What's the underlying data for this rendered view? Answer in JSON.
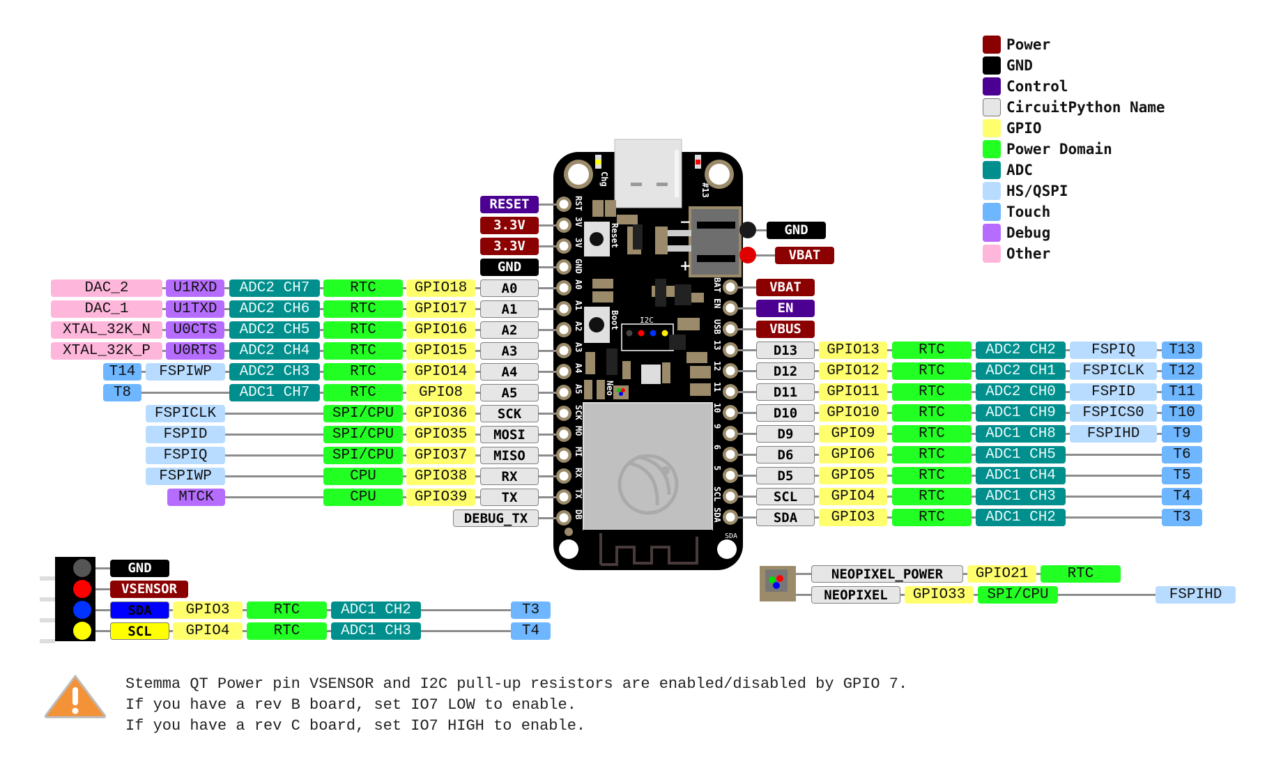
{
  "legend": [
    {
      "label": "Power",
      "color": "#8b0000"
    },
    {
      "label": "GND",
      "color": "#000000"
    },
    {
      "label": "Control",
      "color": "#4b0092"
    },
    {
      "label": "CircuitPython Name",
      "color": "#e6e6e6"
    },
    {
      "label": "GPIO",
      "color": "#ffff6e"
    },
    {
      "label": "Power Domain",
      "color": "#22ff22"
    },
    {
      "label": "ADC",
      "color": "#008f8c"
    },
    {
      "label": "HS/QSPI",
      "color": "#b8dcff"
    },
    {
      "label": "Touch",
      "color": "#6eb6ff"
    },
    {
      "label": "Debug",
      "color": "#b66dff"
    },
    {
      "label": "Other",
      "color": "#ffb6db"
    }
  ],
  "board": {
    "silkscreen_left": [
      "RST",
      "3V",
      "3V",
      "GND",
      "A0",
      "A1",
      "A2",
      "A3",
      "A4",
      "A5",
      "SCK",
      "MO",
      "MI",
      "RX",
      "TX",
      "DB"
    ],
    "silkscreen_right": [
      "BAT",
      "EN",
      "USB",
      "13",
      "12",
      "11",
      "10",
      "9",
      "6",
      "5",
      "SCL",
      "SDA"
    ],
    "labels": {
      "chg": "Chg",
      "led13": "#13",
      "reset": "Reset",
      "boot": "Boot",
      "i2c": "I2C",
      "neo": "Neo"
    }
  },
  "left_pins": [
    {
      "name": "RESET",
      "type": "control"
    },
    {
      "name": "3.3V",
      "type": "power"
    },
    {
      "name": "3.3V",
      "type": "power"
    },
    {
      "name": "GND",
      "type": "gnd"
    },
    {
      "name": "A0",
      "gpio": "GPIO18",
      "domain": "RTC",
      "adc": "ADC2 CH7",
      "debug": "U1RXD",
      "other": "DAC_2"
    },
    {
      "name": "A1",
      "gpio": "GPIO17",
      "domain": "RTC",
      "adc": "ADC2 CH6",
      "debug": "U1TXD",
      "other": "DAC_1"
    },
    {
      "name": "A2",
      "gpio": "GPIO16",
      "domain": "RTC",
      "adc": "ADC2 CH5",
      "debug": "U0CTS",
      "other": "XTAL_32K_N"
    },
    {
      "name": "A3",
      "gpio": "GPIO15",
      "domain": "RTC",
      "adc": "ADC2 CH4",
      "debug": "U0RTS",
      "other": "XTAL_32K_P"
    },
    {
      "name": "A4",
      "gpio": "GPIO14",
      "domain": "RTC",
      "adc": "ADC2 CH3",
      "qspi": "FSPIWP",
      "touch": "T14"
    },
    {
      "name": "A5",
      "gpio": "GPIO8",
      "domain": "RTC",
      "adc": "ADC1 CH7",
      "touch": "T8"
    },
    {
      "name": "SCK",
      "gpio": "GPIO36",
      "domain": "SPI/CPU",
      "qspi_far": "FSPICLK"
    },
    {
      "name": "MOSI",
      "gpio": "GPIO35",
      "domain": "SPI/CPU",
      "qspi_far": "FSPID"
    },
    {
      "name": "MISO",
      "gpio": "GPIO37",
      "domain": "SPI/CPU",
      "qspi_far": "FSPIQ"
    },
    {
      "name": "RX",
      "gpio": "GPIO38",
      "domain": "CPU",
      "qspi_far": "FSPIWP"
    },
    {
      "name": "TX",
      "gpio": "GPIO39",
      "domain": "CPU",
      "debug_far": "MTCK"
    },
    {
      "name": "DEBUG_TX"
    }
  ],
  "right_pins": [
    {
      "name": "VBAT",
      "type": "power"
    },
    {
      "name": "EN",
      "type": "control"
    },
    {
      "name": "VBUS",
      "type": "power"
    },
    {
      "name": "D13",
      "gpio": "GPIO13",
      "domain": "RTC",
      "adc": "ADC2 CH2",
      "qspi": "FSPIQ",
      "touch": "T13"
    },
    {
      "name": "D12",
      "gpio": "GPIO12",
      "domain": "RTC",
      "adc": "ADC2 CH1",
      "qspi": "FSPICLK",
      "touch": "T12"
    },
    {
      "name": "D11",
      "gpio": "GPIO11",
      "domain": "RTC",
      "adc": "ADC2 CH0",
      "qspi": "FSPID",
      "touch": "T11"
    },
    {
      "name": "D10",
      "gpio": "GPIO10",
      "domain": "RTC",
      "adc": "ADC1 CH9",
      "qspi": "FSPICS0",
      "touch": "T10"
    },
    {
      "name": "D9",
      "gpio": "GPIO9",
      "domain": "RTC",
      "adc": "ADC1 CH8",
      "qspi": "FSPIHD",
      "touch": "T9"
    },
    {
      "name": "D6",
      "gpio": "GPIO6",
      "domain": "RTC",
      "adc": "ADC1 CH5",
      "touch": "T6"
    },
    {
      "name": "D5",
      "gpio": "GPIO5",
      "domain": "RTC",
      "adc": "ADC1 CH4",
      "touch": "T5"
    },
    {
      "name": "SCL",
      "gpio": "GPIO4",
      "domain": "RTC",
      "adc": "ADC1 CH3",
      "touch": "T4"
    },
    {
      "name": "SDA",
      "gpio": "GPIO3",
      "domain": "RTC",
      "adc": "ADC1 CH2",
      "touch": "T3"
    }
  ],
  "battery": [
    {
      "name": "GND",
      "type": "gnd",
      "dot": "#1a1a1a"
    },
    {
      "name": "VBAT",
      "type": "power",
      "dot": "#e00000"
    }
  ],
  "stemma": [
    {
      "name": "GND",
      "type": "gnd",
      "dot": "#555555"
    },
    {
      "name": "VSENSOR",
      "type": "power",
      "dot": "#ff0000"
    },
    {
      "name": "SDA",
      "type": "sda",
      "dot": "#0033ff",
      "gpio": "GPIO3",
      "domain": "RTC",
      "adc": "ADC1 CH2",
      "touch": "T3"
    },
    {
      "name": "SCL",
      "type": "scl",
      "dot": "#ffff00",
      "gpio": "GPIO4",
      "domain": "RTC",
      "adc": "ADC1 CH3",
      "touch": "T4"
    }
  ],
  "neopixel": [
    {
      "name": "NEOPIXEL_POWER",
      "gpio": "GPIO21",
      "domain": "RTC"
    },
    {
      "name": "NEOPIXEL",
      "gpio": "GPIO33",
      "domain": "SPI/CPU",
      "qspi": "FSPIHD"
    }
  ],
  "note": {
    "lines": [
      "Stemma QT Power pin VSENSOR and I2C pull-up resistors are enabled/disabled by GPIO 7.",
      "If you have a rev B board, set IO7 LOW to enable.",
      "If you have a rev C board, set IO7 HIGH to enable."
    ]
  },
  "colors": {
    "power": "#8b0000",
    "gnd": "#000000",
    "control": "#4b0092",
    "name": "#e6e6e6",
    "gpio": "#ffff6e",
    "domain": "#22ff22",
    "adc": "#008f8c",
    "qspi": "#b8dcff",
    "touch": "#6eb6ff",
    "debug": "#b66dff",
    "other": "#ffb6db",
    "sda": "#0000ff",
    "scl": "#ffff00",
    "line": "#8c8c8c",
    "pcb": "#000000",
    "pad": "#9b8b6a",
    "warning": "#f39237"
  }
}
